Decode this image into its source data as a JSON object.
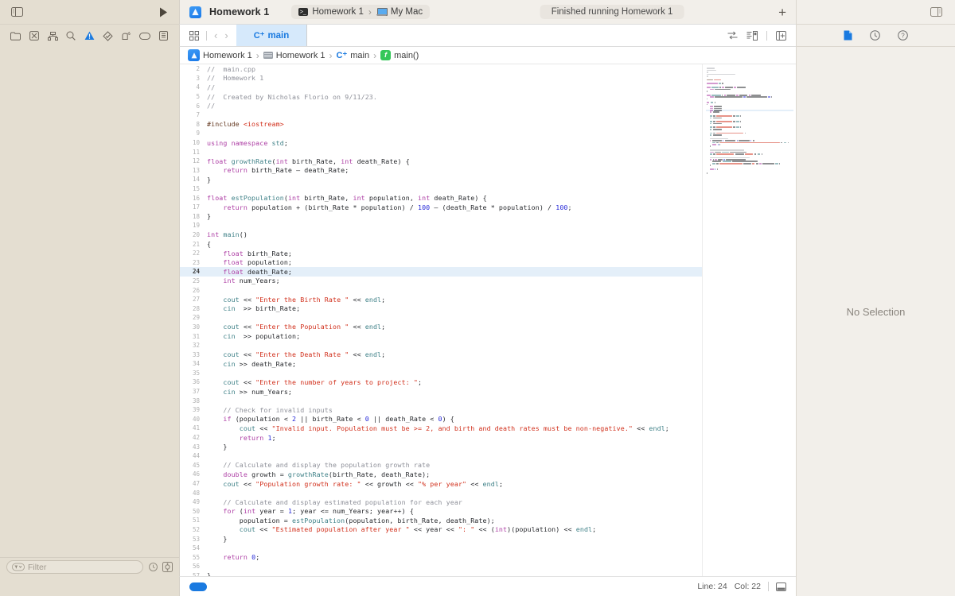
{
  "window": {
    "project_name": "Homework 1",
    "scheme": "Homework 1",
    "destination": "My Mac",
    "status": "Finished running Homework 1",
    "add_label": "+",
    "sidebar_toggle_icon": "sidebar-left-icon",
    "run_icon": "play-icon",
    "inspector_toggle_icon": "sidebar-right-icon"
  },
  "navigator": {
    "icons": [
      {
        "name": "project-navigator-icon",
        "glyph": "folder"
      },
      {
        "name": "source-control-navigator-icon",
        "glyph": "xbox"
      },
      {
        "name": "symbol-navigator-icon",
        "glyph": "hierarchy"
      },
      {
        "name": "find-navigator-icon",
        "glyph": "search"
      },
      {
        "name": "issue-navigator-icon",
        "glyph": "warning"
      },
      {
        "name": "test-navigator-icon",
        "glyph": "diamond"
      },
      {
        "name": "debug-navigator-icon",
        "glyph": "spray"
      },
      {
        "name": "breakpoint-navigator-icon",
        "glyph": "tag"
      },
      {
        "name": "report-navigator-icon",
        "glyph": "report"
      }
    ],
    "filter_placeholder": "Filter",
    "filter_value": ""
  },
  "tabbar": {
    "grid_icon": "tab-overview-icon",
    "back_label": "‹",
    "forward_label": "›",
    "active_tab": "main",
    "active_tab_prefix": "C⁺",
    "editor_icons": [
      {
        "name": "adjust-editor-options-icon"
      },
      {
        "name": "code-review-icon"
      },
      {
        "name": "add-editor-icon"
      }
    ],
    "inspector_icons": [
      {
        "name": "file-inspector-icon"
      },
      {
        "name": "history-inspector-icon"
      },
      {
        "name": "quick-help-inspector-icon"
      }
    ]
  },
  "breadcrumb": [
    {
      "label": "Homework 1",
      "icon": "xcode-project-icon"
    },
    {
      "label": "Homework 1",
      "icon": "folder-icon"
    },
    {
      "label": "main",
      "icon": "cpp-file-icon"
    },
    {
      "label": "main()",
      "icon": "function-icon"
    }
  ],
  "inspector": {
    "empty_message": "No Selection"
  },
  "statusbar": {
    "line_label": "Line: 24",
    "col_label": "Col: 22",
    "minimap_toggle_icon": "minimap-toggle-icon"
  },
  "editor": {
    "file_name": "main.cpp",
    "highlighted_line": 24,
    "first_visible_line": 2,
    "colors": {
      "keyword": "#ad3da4",
      "string": "#d12f1b",
      "comment": "#8e9099",
      "number": "#272ad8",
      "type": "#3e8087",
      "preprocessor": "#643820",
      "plain": "#26282c",
      "highlight_bg": "#e4eff9",
      "accent": "#1a7ae0"
    },
    "lines": [
      {
        "n": 2,
        "t": [
          [
            "cm",
            "//  main.cpp"
          ]
        ]
      },
      {
        "n": 3,
        "t": [
          [
            "cm",
            "//  Homework 1"
          ]
        ]
      },
      {
        "n": 4,
        "t": [
          [
            "cm",
            "//"
          ]
        ]
      },
      {
        "n": 5,
        "t": [
          [
            "cm",
            "//  Created by Nicholas Florio on 9/11/23."
          ]
        ]
      },
      {
        "n": 6,
        "t": [
          [
            "cm",
            "//"
          ]
        ]
      },
      {
        "n": 7,
        "t": []
      },
      {
        "n": 8,
        "t": [
          [
            "pp",
            "#include "
          ],
          [
            "hd",
            "<iostream>"
          ]
        ]
      },
      {
        "n": 9,
        "t": []
      },
      {
        "n": 10,
        "t": [
          [
            "k",
            "using namespace "
          ],
          [
            "tp",
            "std"
          ],
          [
            "",
            "; "
          ]
        ]
      },
      {
        "n": 11,
        "t": []
      },
      {
        "n": 12,
        "t": [
          [
            "k",
            "float "
          ],
          [
            "fn",
            "growthRate"
          ],
          [
            "",
            "("
          ],
          [
            "k",
            "int"
          ],
          [
            "",
            " birth_Rate, "
          ],
          [
            "k",
            "int"
          ],
          [
            "",
            " death_Rate) {"
          ]
        ]
      },
      {
        "n": 13,
        "t": [
          [
            "",
            "    "
          ],
          [
            "k",
            "return"
          ],
          [
            "",
            " birth_Rate — death_Rate;"
          ]
        ]
      },
      {
        "n": 14,
        "t": [
          [
            "",
            "}"
          ]
        ]
      },
      {
        "n": 15,
        "t": []
      },
      {
        "n": 16,
        "t": [
          [
            "k",
            "float "
          ],
          [
            "fn",
            "estPopulation"
          ],
          [
            "",
            "("
          ],
          [
            "k",
            "int"
          ],
          [
            "",
            " birth_Rate, "
          ],
          [
            "k",
            "int"
          ],
          [
            "",
            " population, "
          ],
          [
            "k",
            "int"
          ],
          [
            "",
            " death_Rate) {"
          ]
        ]
      },
      {
        "n": 17,
        "t": [
          [
            "",
            "    "
          ],
          [
            "k",
            "return"
          ],
          [
            "",
            " population + (birth_Rate * population) / "
          ],
          [
            "nu",
            "100"
          ],
          [
            "",
            " — (death_Rate * population) / "
          ],
          [
            "nu",
            "100"
          ],
          [
            "",
            ";"
          ]
        ]
      },
      {
        "n": 18,
        "t": [
          [
            "",
            "}"
          ]
        ]
      },
      {
        "n": 19,
        "t": []
      },
      {
        "n": 20,
        "t": [
          [
            "k",
            "int "
          ],
          [
            "fn",
            "main"
          ],
          [
            "",
            "()"
          ]
        ]
      },
      {
        "n": 21,
        "t": [
          [
            "",
            "{"
          ]
        ]
      },
      {
        "n": 22,
        "t": [
          [
            "",
            "    "
          ],
          [
            "k",
            "float"
          ],
          [
            "",
            " birth_Rate;"
          ]
        ]
      },
      {
        "n": 23,
        "t": [
          [
            "",
            "    "
          ],
          [
            "k",
            "float"
          ],
          [
            "",
            " population;"
          ]
        ]
      },
      {
        "n": 24,
        "t": [
          [
            "",
            "    "
          ],
          [
            "k",
            "float"
          ],
          [
            "",
            " death_Rate;"
          ]
        ]
      },
      {
        "n": 25,
        "t": [
          [
            "",
            "    "
          ],
          [
            "k",
            "int"
          ],
          [
            "",
            " num_Years;"
          ]
        ]
      },
      {
        "n": 26,
        "t": []
      },
      {
        "n": 27,
        "t": [
          [
            "",
            "    "
          ],
          [
            "tp",
            "cout"
          ],
          [
            "",
            " << "
          ],
          [
            "st",
            "\"Enter the Birth Rate \""
          ],
          [
            "",
            " << "
          ],
          [
            "tp",
            "endl"
          ],
          [
            "",
            ";"
          ]
        ]
      },
      {
        "n": 28,
        "t": [
          [
            "",
            "    "
          ],
          [
            "tp",
            "cin"
          ],
          [
            "",
            "  >> birth_Rate;"
          ]
        ]
      },
      {
        "n": 29,
        "t": []
      },
      {
        "n": 30,
        "t": [
          [
            "",
            "    "
          ],
          [
            "tp",
            "cout"
          ],
          [
            "",
            " << "
          ],
          [
            "st",
            "\"Enter the Population \""
          ],
          [
            "",
            " << "
          ],
          [
            "tp",
            "endl"
          ],
          [
            "",
            ";"
          ]
        ]
      },
      {
        "n": 31,
        "t": [
          [
            "",
            "    "
          ],
          [
            "tp",
            "cin"
          ],
          [
            "",
            "  >> population;"
          ]
        ]
      },
      {
        "n": 32,
        "t": []
      },
      {
        "n": 33,
        "t": [
          [
            "",
            "    "
          ],
          [
            "tp",
            "cout"
          ],
          [
            "",
            " << "
          ],
          [
            "st",
            "\"Enter the Death Rate \""
          ],
          [
            "",
            " << "
          ],
          [
            "tp",
            "endl"
          ],
          [
            "",
            ";"
          ]
        ]
      },
      {
        "n": 34,
        "t": [
          [
            "",
            "    "
          ],
          [
            "tp",
            "cin"
          ],
          [
            "",
            " >> death_Rate;"
          ]
        ]
      },
      {
        "n": 35,
        "t": []
      },
      {
        "n": 36,
        "t": [
          [
            "",
            "    "
          ],
          [
            "tp",
            "cout"
          ],
          [
            "",
            " << "
          ],
          [
            "st",
            "\"Enter the number of years to project: \""
          ],
          [
            "",
            ";"
          ]
        ]
      },
      {
        "n": 37,
        "t": [
          [
            "",
            "    "
          ],
          [
            "tp",
            "cin"
          ],
          [
            "",
            " >> num_Years;"
          ]
        ]
      },
      {
        "n": 38,
        "t": []
      },
      {
        "n": 39,
        "t": [
          [
            "",
            "    "
          ],
          [
            "cm",
            "// Check for invalid inputs"
          ]
        ]
      },
      {
        "n": 40,
        "t": [
          [
            "",
            "    "
          ],
          [
            "k",
            "if"
          ],
          [
            "",
            " (population < "
          ],
          [
            "nu",
            "2"
          ],
          [
            "",
            " || birth_Rate < "
          ],
          [
            "nu",
            "0"
          ],
          [
            "",
            " || death_Rate < "
          ],
          [
            "nu",
            "0"
          ],
          [
            "",
            ") {"
          ]
        ]
      },
      {
        "n": 41,
        "t": [
          [
            "",
            "        "
          ],
          [
            "tp",
            "cout"
          ],
          [
            "",
            " << "
          ],
          [
            "st",
            "\"Invalid input. Population must be >= 2, and birth and death rates must be non-negative.\""
          ],
          [
            "",
            " << "
          ],
          [
            "tp",
            "endl"
          ],
          [
            "",
            ";"
          ]
        ]
      },
      {
        "n": 42,
        "t": [
          [
            "",
            "        "
          ],
          [
            "k",
            "return"
          ],
          [
            "",
            " "
          ],
          [
            "nu",
            "1"
          ],
          [
            "",
            ";"
          ]
        ]
      },
      {
        "n": 43,
        "t": [
          [
            "",
            "    }"
          ]
        ]
      },
      {
        "n": 44,
        "t": []
      },
      {
        "n": 45,
        "t": [
          [
            "",
            "    "
          ],
          [
            "cm",
            "// Calculate and display the population growth rate"
          ]
        ]
      },
      {
        "n": 46,
        "t": [
          [
            "",
            "    "
          ],
          [
            "k",
            "double"
          ],
          [
            "",
            " growth = "
          ],
          [
            "fn",
            "growthRate"
          ],
          [
            "",
            "(birth_Rate, death_Rate);"
          ]
        ]
      },
      {
        "n": 47,
        "t": [
          [
            "",
            "    "
          ],
          [
            "tp",
            "cout"
          ],
          [
            "",
            " << "
          ],
          [
            "st",
            "\"Population growth rate: \""
          ],
          [
            "",
            " << growth << "
          ],
          [
            "st",
            "\"% per year\""
          ],
          [
            "",
            " << "
          ],
          [
            "tp",
            "endl"
          ],
          [
            "",
            ";"
          ]
        ]
      },
      {
        "n": 48,
        "t": []
      },
      {
        "n": 49,
        "t": [
          [
            "",
            "    "
          ],
          [
            "cm",
            "// Calculate and display estimated population for each year"
          ]
        ]
      },
      {
        "n": 50,
        "t": [
          [
            "",
            "    "
          ],
          [
            "k",
            "for"
          ],
          [
            "",
            " ("
          ],
          [
            "k",
            "int"
          ],
          [
            "",
            " year = "
          ],
          [
            "nu",
            "1"
          ],
          [
            "",
            "; year <= num_Years; year++) {"
          ]
        ]
      },
      {
        "n": 51,
        "t": [
          [
            "",
            "        population = "
          ],
          [
            "fn",
            "estPopulation"
          ],
          [
            "",
            "(population, birth_Rate, death_Rate);"
          ]
        ]
      },
      {
        "n": 52,
        "t": [
          [
            "",
            "        "
          ],
          [
            "tp",
            "cout"
          ],
          [
            "",
            " << "
          ],
          [
            "st",
            "\"Estimated population after year \""
          ],
          [
            "",
            " << year << "
          ],
          [
            "st",
            "\": \""
          ],
          [
            "",
            " << ("
          ],
          [
            "k",
            "int"
          ],
          [
            "",
            ")(population) << "
          ],
          [
            "tp",
            "endl"
          ],
          [
            "",
            ";"
          ]
        ]
      },
      {
        "n": 53,
        "t": [
          [
            "",
            "    }"
          ]
        ]
      },
      {
        "n": 54,
        "t": []
      },
      {
        "n": 55,
        "t": [
          [
            "",
            "    "
          ],
          [
            "k",
            "return"
          ],
          [
            "",
            " "
          ],
          [
            "nu",
            "0"
          ],
          [
            "",
            ";"
          ]
        ]
      },
      {
        "n": 56,
        "t": []
      },
      {
        "n": 57,
        "t": [
          [
            "",
            "}"
          ]
        ]
      }
    ]
  }
}
